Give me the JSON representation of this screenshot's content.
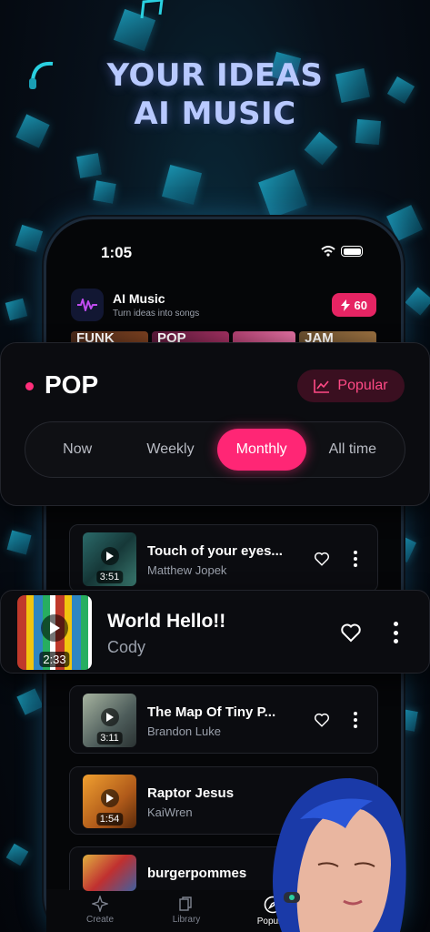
{
  "headline": {
    "line1": "YOUR IDEAS",
    "line2": "AI MUSIC"
  },
  "status": {
    "time": "1:05"
  },
  "app": {
    "title": "AI Music",
    "subtitle": "Turn ideas into songs",
    "credits": "60"
  },
  "genres": [
    "FUNK",
    "POP",
    "",
    "JAM"
  ],
  "filter": {
    "genre": "POP",
    "popular_label": "Popular",
    "periods": [
      "Now",
      "Weekly",
      "Monthly",
      "All time"
    ],
    "active_period": "Monthly"
  },
  "songs": [
    {
      "title": "Touch of your eyes...",
      "artist": "Matthew Jopek",
      "duration": "3:51"
    },
    {
      "title": "World Hello!!",
      "artist": "Cody",
      "duration": "2:33"
    },
    {
      "title": "The Map Of Tiny P...",
      "artist": "Brandon Luke",
      "duration": "3:11"
    },
    {
      "title": "Raptor Jesus",
      "artist": "KaiWren",
      "duration": "1:54"
    },
    {
      "title": "burgerpommes",
      "artist": "",
      "duration": ""
    }
  ],
  "nav": {
    "create": "Create",
    "library": "Library",
    "popular": "Popular"
  },
  "colors": {
    "accent": "#ff2675",
    "credit_bg": "#e62463",
    "headline": "#b8c9ff"
  }
}
